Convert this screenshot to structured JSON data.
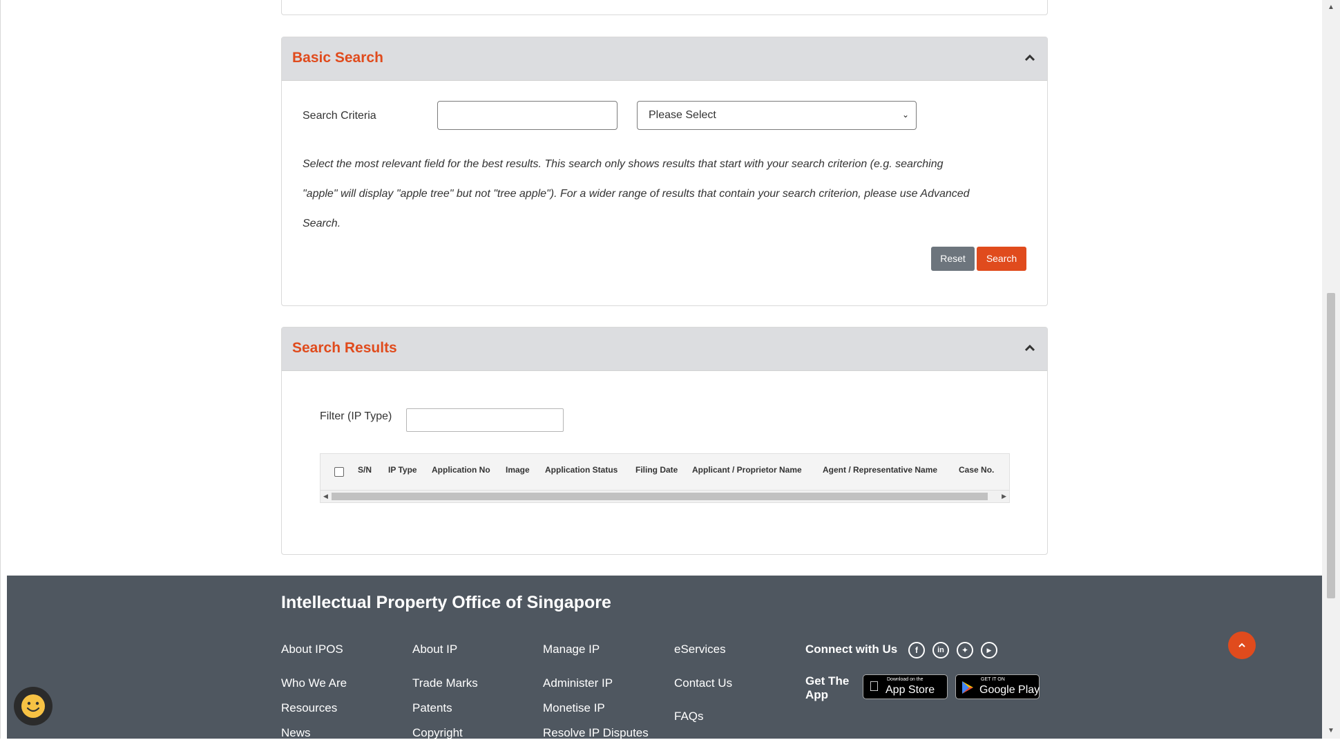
{
  "basic_search": {
    "title": "Basic Search",
    "criteria_label": "Search Criteria",
    "criteria_value": "",
    "select_value": "Please Select",
    "hint_line1": "Select the most relevant field for the best results. This search only shows results that start with your search criterion (e.g. searching",
    "hint_line2": "\"apple\" will display \"apple tree\" but not \"tree apple\"). For a wider range of results that contain your search criterion, please use Advanced",
    "hint_line3": "Search.",
    "reset_label": "Reset",
    "search_label": "Search"
  },
  "search_results": {
    "title": "Search Results",
    "filter_label": "Filter (IP Type)",
    "filter_value": "",
    "columns": [
      "S/N",
      "IP Type",
      "Application No",
      "Image",
      "Application Status",
      "Filing Date",
      "Applicant / Proprietor Name",
      "Agent / Representative Name",
      "Case No."
    ]
  },
  "footer": {
    "title": "Intellectual Property Office of Singapore",
    "col1": [
      "About IPOS",
      "Who We Are",
      "Resources",
      "News"
    ],
    "col2": [
      "About IP",
      "Trade Marks",
      "Patents",
      "Copyright"
    ],
    "col3": [
      "Manage IP",
      "Administer IP",
      "Monetise IP",
      "Resolve IP Disputes"
    ],
    "col4": [
      "eServices",
      "Contact Us",
      "FAQs"
    ],
    "connect": "Connect with Us",
    "social_icons": [
      "facebook-icon",
      "linkedin-icon",
      "twitter-icon",
      "youtube-icon"
    ],
    "get_app_line1": "Get The",
    "get_app_line2": "App",
    "app_store_small": "Download on the",
    "app_store_big": "App Store",
    "google_play_small": "GET IT ON",
    "google_play_big": "Google Play"
  },
  "colors": {
    "accent": "#e04b1d",
    "header_bg": "#dcdde0",
    "footer_bg": "#4f5760",
    "reset_bg": "#6d757d"
  }
}
